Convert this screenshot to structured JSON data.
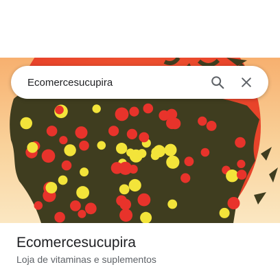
{
  "search": {
    "query": "Ecomercesucupira",
    "search_icon": "search-icon",
    "clear_icon": "close-icon"
  },
  "place": {
    "name": "Ecomercesucupira",
    "category": "Loja de vitaminas e suplementos"
  },
  "colors": {
    "sky_top": "#f9b777",
    "sky_bottom": "#fbe4bb",
    "sun": "#ee4b2a",
    "tree": "#3f3d1f",
    "fruit_red": "#e8332b",
    "fruit_yellow": "#f3e43a"
  }
}
